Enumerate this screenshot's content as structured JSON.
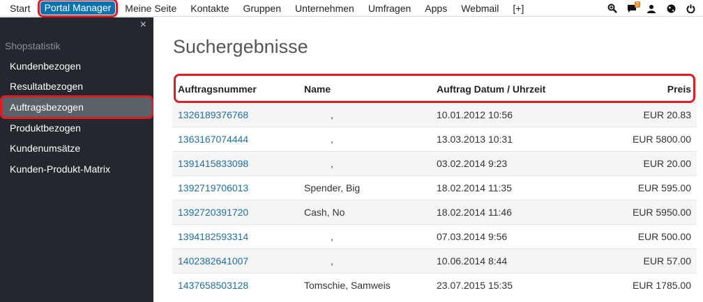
{
  "topbar": {
    "nav": [
      "Start",
      "Portal Manager",
      "Meine Seite",
      "Kontakte",
      "Gruppen",
      "Unternehmen",
      "Umfragen",
      "Apps",
      "Webmail",
      "[+]"
    ],
    "active_index": 1,
    "icons": [
      "search-zoom-icon",
      "chat-icon",
      "user-icon",
      "globe-icon",
      "power-icon"
    ],
    "chat_badge": "2",
    "highlight_color": "#e01b24",
    "accent_color": "#0f72b0"
  },
  "sidebar": {
    "close_label": "×",
    "heading": "Shopstatistik",
    "items": [
      {
        "label": "Kundenbezogen"
      },
      {
        "label": "Resultatbezogen"
      },
      {
        "label": "Auftragsbezogen"
      },
      {
        "label": "Produktbezogen"
      },
      {
        "label": "Kundenumsätze"
      },
      {
        "label": "Kunden-Produkt-Matrix"
      }
    ],
    "active_index": 2
  },
  "main": {
    "title": "Suchergebnisse",
    "columns": [
      "Auftragsnummer",
      "Name",
      "Auftrag Datum / Uhrzeit",
      "Preis"
    ],
    "rows": [
      {
        "order": "1326189376768",
        "name": ",",
        "date": "10.01.2012 10:56",
        "price": "EUR 20.83"
      },
      {
        "order": "1363167074444",
        "name": ",",
        "date": "13.03.2013 10:31",
        "price": "EUR 5800.00"
      },
      {
        "order": "1391415833098",
        "name": ",",
        "date": "03.02.2014 9:23",
        "price": "EUR 20.00"
      },
      {
        "order": "1392719706013",
        "name": "Spender, Big",
        "date": "18.02.2014 11:35",
        "price": "EUR 595.00"
      },
      {
        "order": "1392720391720",
        "name": "Cash, No",
        "date": "18.02.2014 11:46",
        "price": "EUR 5950.00"
      },
      {
        "order": "1394182593314",
        "name": ",",
        "date": "07.03.2014 9:56",
        "price": "EUR 500.00"
      },
      {
        "order": "1402382641007",
        "name": ",",
        "date": "10.06.2014 8:44",
        "price": "EUR 57.00"
      },
      {
        "order": "1437658503128",
        "name": "Tomschie, Samweis",
        "date": "23.07.2015 15:35",
        "price": "EUR 1785.00"
      }
    ]
  }
}
